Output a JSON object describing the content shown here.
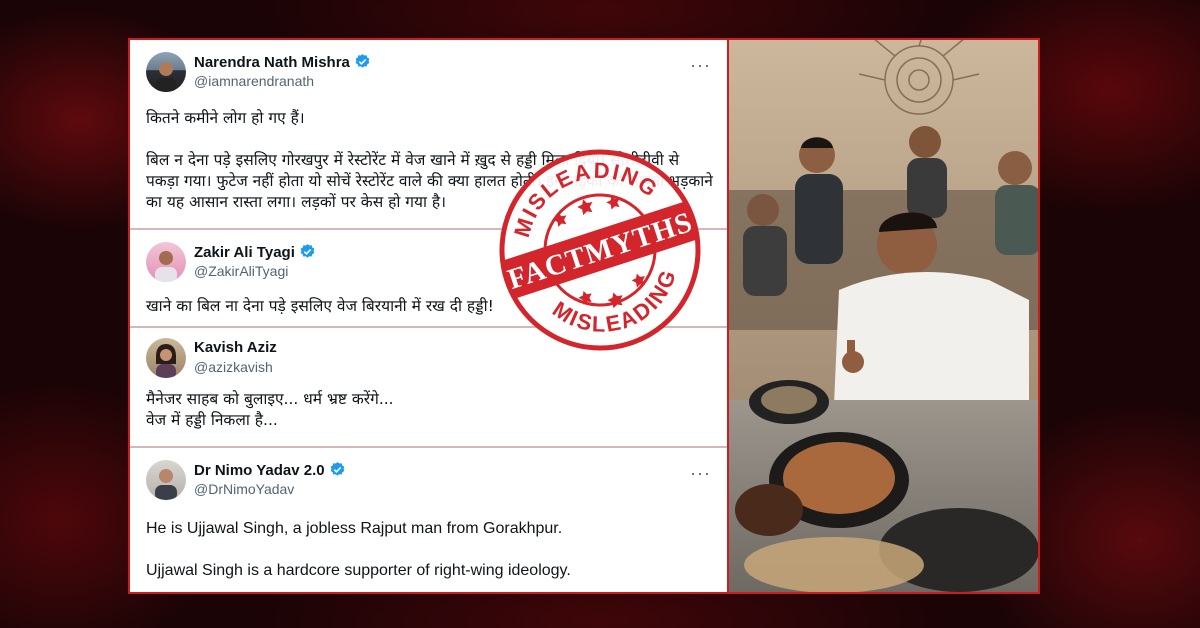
{
  "tweets": [
    {
      "name": "Narendra Nath Mishra",
      "handle": "@iamnarendranath",
      "text": "कितने कमीने लोग हो गए हैं।\n\nबिल न देना पड़े इसलिए गोरखपुर में रेस्टोरेंट में वेज खाने में ख़ुद से हड्डी मिला दिया। सीसीटीवी से पकड़ा गया। फुटेज नहीं होता यो सोचें रेस्टोरेंट वाले की क्या हालत होती। इन लड़कों को भावना भड़काने का यह आसान रास्ता लगा। लड़कों पर केस हो गया है।",
      "verified": true
    },
    {
      "name": "Zakir Ali Tyagi",
      "handle": "@ZakirAliTyagi",
      "text": "खाने का बिल ना देना पड़े इसलिए वेज बिरयानी में रख दी हड्डी!",
      "verified": true
    },
    {
      "name": "Kavish Aziz",
      "handle": "@azizkavish",
      "text": "मैनेजर साहब को बुलाइए... धर्म भ्रष्ट करेंगे...\nवेज में हड्डी निकला है...",
      "verified": false
    },
    {
      "name": "Dr Nimo Yadav 2.0",
      "handle": "@DrNimoYadav",
      "text": "He is Ujjawal Singh, a jobless Rajput man from Gorakhpur.\n\nUjjawal Singh is a hardcore supporter of right-wing ideology.",
      "verified": true
    }
  ],
  "more_label": "···",
  "stamp": {
    "top": "MISLEADING",
    "center": "FACTMYTHS",
    "bottom": "MISLEADING",
    "color": "#d3262c"
  },
  "colors": {
    "frame": "#c81e1e",
    "verified": "#1d9bf0",
    "background": "#1a0406"
  }
}
